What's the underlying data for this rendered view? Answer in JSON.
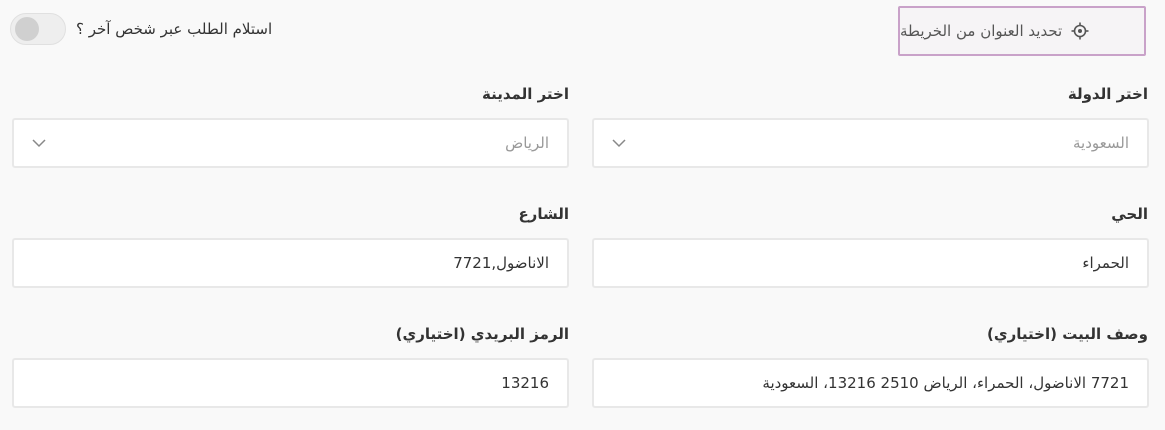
{
  "map_button": {
    "label": "تحديد العنوان من الخريطة",
    "icon": "location-target-icon"
  },
  "receive_toggle": {
    "label": "استلام الطلب عبر شخص آخر ؟",
    "checked": false
  },
  "country": {
    "label": "اختر الدولة",
    "value": "السعودية",
    "icon": "chevron-down-icon"
  },
  "city": {
    "label": "اختر المدينة",
    "value": "الرياض",
    "icon": "chevron-down-icon"
  },
  "district": {
    "label": "الحي",
    "value": "الحمراء"
  },
  "street": {
    "label": "الشارع",
    "value": "الاناضول,7721"
  },
  "house_desc": {
    "label": "وصف البيت (اختياري)",
    "value": "7721 الاناضول، الحمراء، الرياض 2510 13216، السعودية"
  },
  "postal_code": {
    "label": "الرمز البريدي (اختياري)",
    "value": "13216"
  },
  "colors": {
    "accent_border": "#c9a2c9",
    "field_border": "#e8e8e8",
    "background": "#f9f9f9"
  }
}
